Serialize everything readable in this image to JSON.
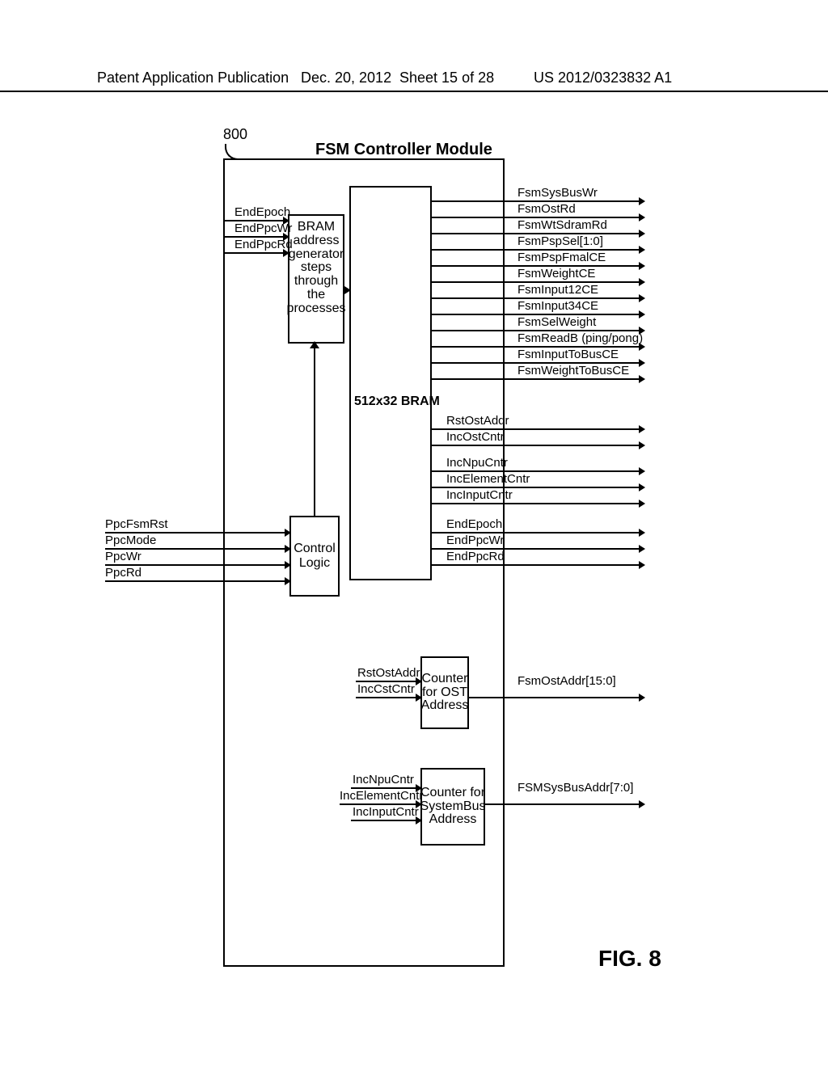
{
  "header": {
    "left": "Patent Application Publication",
    "date": "Dec. 20, 2012",
    "sheet": "Sheet 15 of 28",
    "pubno": "US 2012/0323832 A1"
  },
  "ref": "800",
  "title": "FSM Controller Module",
  "bram_addr_text": "BRAM address generator steps through the processes",
  "bram_label": "512x32 BRAM",
  "ctrl_label1": "Control",
  "ctrl_label2": "Logic",
  "cnt_ost": "Counter for OST Address",
  "cnt_sys": "Counter for SystemBus Address",
  "fig": "FIG. 8",
  "in_bram": {
    "a": "EndEpoch",
    "b": "EndPpcWr",
    "c": "EndPpcRd"
  },
  "in_ctrl": {
    "a": "PpcFsmRst",
    "b": "PpcMode",
    "c": "PpcWr",
    "d": "PpcRd"
  },
  "out_top": {
    "a": "FsmSysBusWr",
    "b": "FsmOstRd",
    "c": "FsmWtSdramRd",
    "d": "FsmPspSel[1:0]",
    "e": "FsmPspFmalCE",
    "f": "FsmWeightCE",
    "g": "FsmInput12CE",
    "h": "FsmInput34CE",
    "i": "FsmSelWeight",
    "j": "FsmReadB (ping/pong)",
    "k": "FsmInputToBusCE",
    "l": "FsmWeightToBusCE"
  },
  "out_mid1": {
    "a": "RstOstAddr",
    "b": "IncOstCntr"
  },
  "out_mid2": {
    "a": "IncNpuCntr",
    "b": "IncElementCntr",
    "c": "IncInputCntr"
  },
  "out_mid3": {
    "a": "EndEpoch",
    "b": "EndPpcWr",
    "c": "EndPpcRd"
  },
  "ost_in": {
    "a": "RstOstAddr",
    "b": "IncCstCntr"
  },
  "sys_in": {
    "a": "IncNpuCntr",
    "b": "IncElementCntr",
    "c": "IncInputCntr"
  },
  "ost_out": "FsmOstAddr[15:0]",
  "sys_out": "FSMSysBusAddr[7:0]"
}
